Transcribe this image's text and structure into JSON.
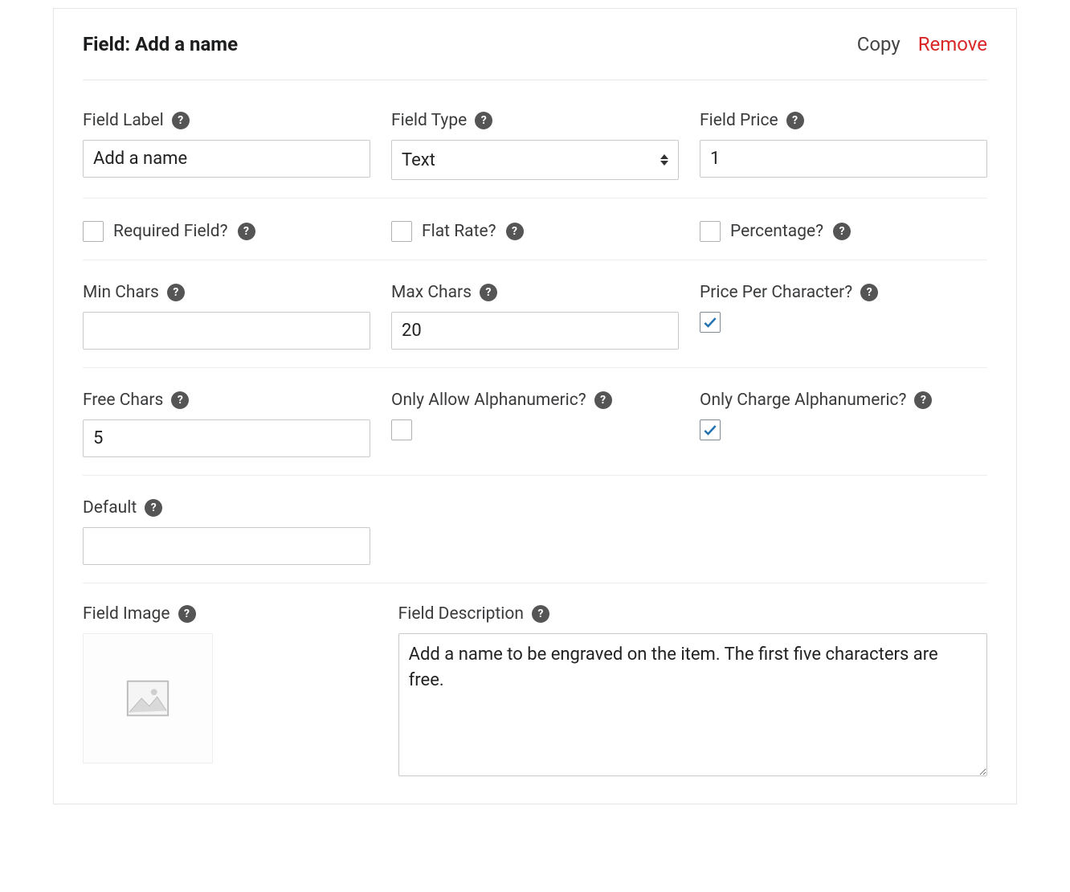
{
  "header": {
    "title": "Field: Add a name",
    "copy": "Copy",
    "remove": "Remove"
  },
  "row1": {
    "field_label": {
      "label": "Field Label",
      "value": "Add a name"
    },
    "field_type": {
      "label": "Field Type",
      "value": "Text"
    },
    "field_price": {
      "label": "Field Price",
      "value": "1"
    }
  },
  "row2": {
    "required": {
      "label": "Required Field?",
      "checked": false
    },
    "flat_rate": {
      "label": "Flat Rate?",
      "checked": false
    },
    "percentage": {
      "label": "Percentage?",
      "checked": false
    }
  },
  "row3": {
    "min_chars": {
      "label": "Min Chars",
      "value": ""
    },
    "max_chars": {
      "label": "Max Chars",
      "value": "20"
    },
    "price_per_char": {
      "label": "Price Per Character?",
      "checked": true
    }
  },
  "row4": {
    "free_chars": {
      "label": "Free Chars",
      "value": "5"
    },
    "only_allow_alnum": {
      "label": "Only Allow Alphanumeric?",
      "checked": false
    },
    "only_charge_alnum": {
      "label": "Only Charge Alphanumeric?",
      "checked": true
    }
  },
  "row5": {
    "default": {
      "label": "Default",
      "value": ""
    }
  },
  "row6": {
    "field_image": {
      "label": "Field Image"
    },
    "field_description": {
      "label": "Field Description",
      "value": "Add a name to be engraved on the item. The first five characters are free."
    }
  }
}
